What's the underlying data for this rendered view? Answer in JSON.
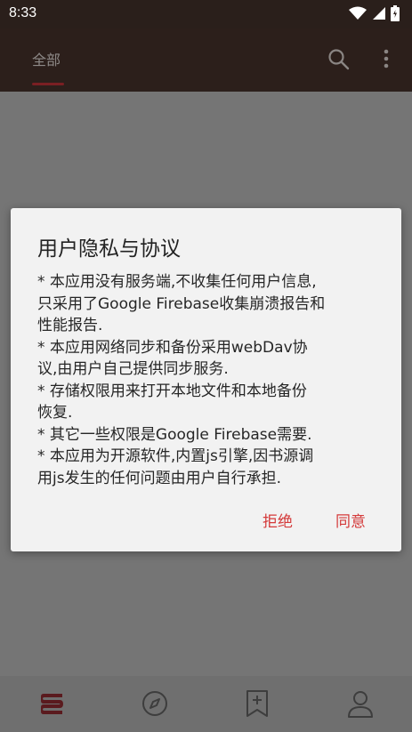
{
  "status_bar": {
    "time": "8:33"
  },
  "app_bar": {
    "tab_label": "全部",
    "accent_color": "#7a1f23"
  },
  "dialog": {
    "title": "用户隐私与协议",
    "body": "* 本应用没有服务端,不收集任何用户信息,\n只采用了Google Firebase收集崩溃报告和\n性能报告.\n* 本应用网络同步和备份采用webDav协\n议,由用户自己提供同步服务.\n* 存储权限用来打开本地文件和本地备份\n恢复.\n* 其它一些权限是Google Firebase需要.\n* 本应用为开源软件,内置js引擎,因书源调\n用js发生的任何问题由用户自行承担.",
    "refuse_label": "拒绝",
    "agree_label": "同意",
    "button_color": "#d43a3a"
  },
  "bottom_nav": {
    "items": [
      "bookshelf-icon",
      "compass-icon",
      "bookmark-add-icon",
      "person-icon"
    ]
  }
}
